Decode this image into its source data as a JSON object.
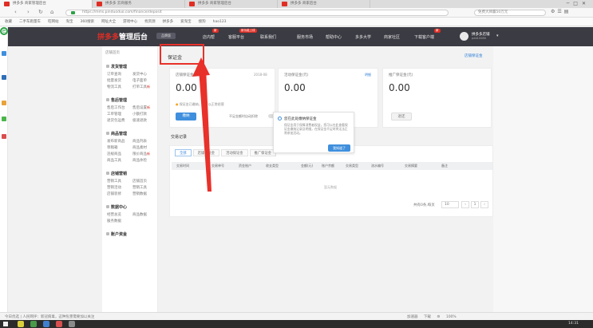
{
  "browser": {
    "tabs": [
      {
        "label": "拼多多 商家管理后台"
      },
      {
        "label": "拼多多 云商服务"
      },
      {
        "label": "拼多多 商家管理后台"
      },
      {
        "label": "拼多多 商家后台"
      }
    ],
    "url": "https://mms.pinduoduo.com/finance/deposit",
    "search_placeholder": "免费大牌赢50万元",
    "bookmarks": [
      "收藏",
      "二手车跑量车",
      "旺网站",
      "淘宝",
      "360搜索",
      "网址大全",
      "游戏中心",
      "找资源",
      "拼多多",
      "爱淘宝",
      "搜狗",
      "hao123"
    ]
  },
  "header": {
    "logo_brand": "拼多多",
    "logo_suffix": "管理后台",
    "badge": "品牌版",
    "nav": [
      {
        "label": "店内帮"
      },
      {
        "label": "客服平台"
      },
      {
        "label": "联系我们"
      },
      {
        "label": "服务市场"
      },
      {
        "label": "帮助中心"
      },
      {
        "label": "多多大学"
      },
      {
        "label": "商家社区"
      },
      {
        "label": "下载客户端"
      }
    ],
    "new_tags": [
      "新",
      "新功能上线",
      "新"
    ],
    "user_name": "拼多多店铺",
    "user_sub": "pdd10086"
  },
  "sidebar": {
    "top_label": "店铺首页",
    "sections": [
      {
        "title": "发货管理",
        "items": [
          "订单查询",
          "发货中心",
          "批量发货",
          "电子面单",
          "物流工具",
          "打单工具"
        ]
      },
      {
        "title": "售后管理",
        "items": [
          "售后工作台",
          "售后设置",
          "工单管理",
          "小额打款",
          "退货包运费",
          "极速退款"
        ]
      },
      {
        "title": "商品管理",
        "items": [
          "发布新商品",
          "商品列表",
          "草稿箱",
          "商品素材",
          "违规商品",
          "限价商品",
          "商品工具",
          "商品体检"
        ]
      },
      {
        "title": "店铺营销",
        "items": [
          "营销工具",
          "店铺首页",
          "营销活动",
          "营销工具",
          "店铺装修",
          "营销数据"
        ]
      },
      {
        "title": "数据中心",
        "items": [
          "经营总览",
          "商品数据",
          "服务数据"
        ]
      },
      {
        "title": "账户资金",
        "items": []
      }
    ],
    "new_badge": "新"
  },
  "main": {
    "page_title": "保证金",
    "top_link": "店铺保证金",
    "cards": [
      {
        "title": "店铺保证金(元)",
        "date": "2018-08",
        "value": "0.00",
        "note": "保证金已缴纳，您可以正常经营",
        "button": "缴纳",
        "toggle_label": "不足金额时自动扣除"
      },
      {
        "title": "活动保证金(元)",
        "link": "明细",
        "value": "0.00"
      },
      {
        "title": "推广保证金(元)",
        "value": "0.00",
        "button": "退还"
      }
    ],
    "tooltip": {
      "title": "您在此处缴纳保证金",
      "body": "保证金用于保障消费者权益，您可以在此查看保证金缴纳记录及明细，在保证金不足时将无法正常参加活动。",
      "button": "我知道了"
    },
    "records_title": "交易记录",
    "record_tabs": [
      "全部",
      "店铺保证金",
      "活动保证金",
      "推广保证金"
    ],
    "table_headers": [
      "交易时间",
      "交易单号",
      "资金账户",
      "收支类型",
      "金额(元)",
      "账户余额",
      "交易类型",
      "流水编号",
      "交易摘要",
      "备注"
    ],
    "empty_text": "暂无数据",
    "pager": {
      "summary": "共有0条,每页",
      "page_size": "10",
      "prev": "‹",
      "page": "1",
      "next": "›"
    }
  },
  "statusbar": {
    "left": "今日优选  |  人民网评：新冠病毒，这种危害需要加以关注",
    "right": "加速器 下载 ⚙ 100%"
  },
  "taskbar": {
    "time": "14:31"
  },
  "colors": {
    "brand": "#e02e24",
    "header_bg": "#3b3b44",
    "primary": "#3f8fdd",
    "highlight": "#e8312a"
  }
}
